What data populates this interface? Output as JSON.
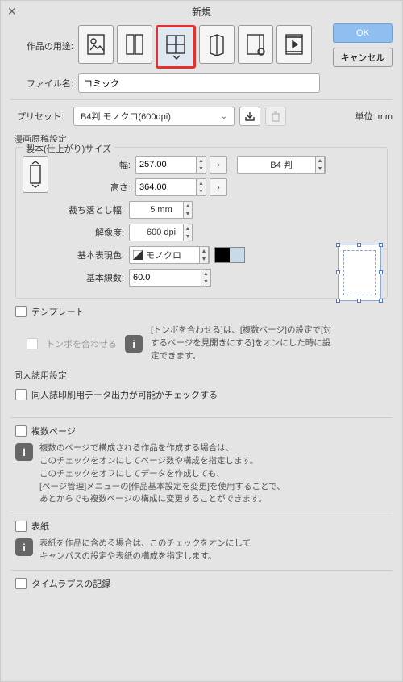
{
  "title": "新規",
  "buttons": {
    "ok": "OK",
    "cancel": "キャンセル"
  },
  "labels": {
    "purpose": "作品の用途:",
    "filename": "ファイル名:",
    "preset": "プリセット:",
    "unit": "単位:  mm",
    "manga_group": "漫画原稿設定",
    "binding_group": "製本(仕上がり)サイズ",
    "width": "幅:",
    "height": "高さ:",
    "bleed": "裁ち落とし幅:",
    "resolution": "解像度:",
    "color_mode": "基本表現色:",
    "line_count": "基本線数:",
    "template": "テンプレート",
    "tombo": "トンボを合わせる",
    "doujin_head": "同人誌用設定",
    "doujin_check": "同人誌印刷用データ出力が可能かチェックする",
    "multipage": "複数ページ",
    "cover": "表紙",
    "timelapse": "タイムラプスの記録"
  },
  "values": {
    "filename": "コミック",
    "preset": "B4判 モノクロ(600dpi)",
    "width": "257.00",
    "height": "364.00",
    "bleed": "5 mm",
    "resolution": "600 dpi",
    "color_mode": "モノクロ",
    "size_preset": "B4 判",
    "line_count": "60.0"
  },
  "info": {
    "tombo": "[トンボを合わせる]は、[複数ページ]の設定で[対するページを見開きにする]をオンにした時に設定できます。",
    "multipage": "複数のページで構成される作品を作成する場合は、\nこのチェックをオンにしてページ数や構成を指定します。\nこのチェックをオフにしてデータを作成しても、\n[ページ管理]メニューの[作品基本設定を変更]を使用することで、\nあとからでも複数ページの構成に変更することができます。",
    "cover": "表紙を作品に含める場合は、このチェックをオンにして\nキャンバスの設定や表紙の構成を指定します。"
  }
}
